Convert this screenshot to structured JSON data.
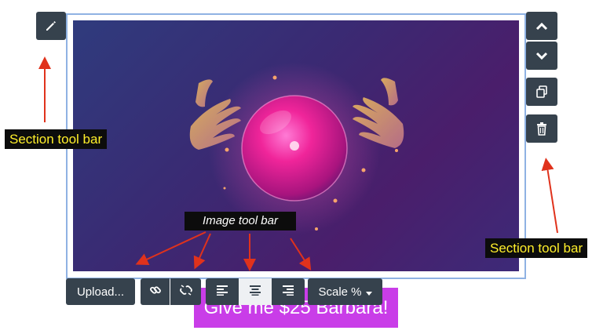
{
  "labels": {
    "section_toolbar_left": "Section tool bar",
    "section_toolbar_right": "Section tool bar",
    "image_toolbar": "Image tool bar"
  },
  "image_toolbar": {
    "upload_label": "Upload...",
    "scale_label": "Scale %"
  },
  "cta": {
    "label": "Give me $25 Barbara!"
  },
  "icons": {
    "edit": "pencil-icon",
    "move_up": "chevron-up-icon",
    "move_down": "chevron-down-icon",
    "duplicate": "copy-icon",
    "delete": "trash-icon",
    "link": "link-icon",
    "unlink": "unlink-icon",
    "align_left": "align-left-icon",
    "align_center": "align-center-icon",
    "align_right": "align-right-icon",
    "dropdown": "caret-down-icon"
  },
  "colors": {
    "toolbar_bg": "#36424d",
    "cta_bg": "#c93de8",
    "frame_border": "#8fb2e3",
    "annotation_arrow": "#e0321c",
    "annotation_text": "#ffef2a"
  }
}
